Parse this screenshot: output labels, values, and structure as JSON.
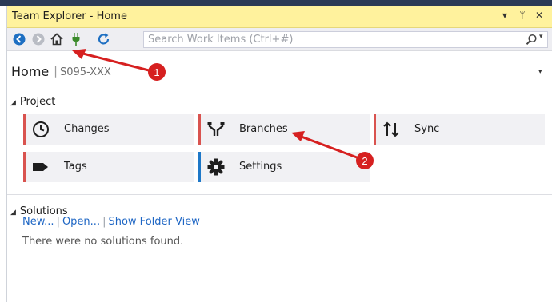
{
  "window": {
    "title": "Team Explorer - Home",
    "controls": {
      "dropdown": "▾",
      "pin": "ᛘ",
      "close": "✕"
    }
  },
  "toolbar": {
    "search_placeholder": "Search Work Items (Ctrl+#)",
    "search_dropdown": "▾",
    "icons": [
      "back-icon",
      "forward-icon",
      "home-icon",
      "plug-icon",
      "refresh-icon",
      "search-icon"
    ]
  },
  "home": {
    "title": "Home",
    "separator": "|",
    "server": "S095-XXX",
    "caret": "▾"
  },
  "project": {
    "header": "Project",
    "collapse_glyph": "◢",
    "tiles": [
      {
        "label": "Changes",
        "icon": "clock-icon",
        "accent": "#d9534f"
      },
      {
        "label": "Branches",
        "icon": "branch-icon",
        "accent": "#d9534f"
      },
      {
        "label": "Sync",
        "icon": "sync-arrows-icon",
        "accent": "#d9534f"
      },
      {
        "label": "Tags",
        "icon": "tag-icon",
        "accent": "#d9534f"
      },
      {
        "label": "Settings",
        "icon": "gear-icon",
        "accent": "#1e78c8"
      }
    ]
  },
  "solutions": {
    "header": "Solutions",
    "collapse_glyph": "◢",
    "links": [
      "New...",
      "Open...",
      "Show Folder View"
    ],
    "link_separator": "|",
    "empty_message": "There were no solutions found."
  },
  "annotations": [
    {
      "number": "1",
      "color": "#d62020"
    },
    {
      "number": "2",
      "color": "#d62020"
    }
  ],
  "colors": {
    "title_bar": "#fff29d",
    "toolbar": "#eeeef2",
    "tile_bg": "#f1f1f4",
    "link": "#1e66c4",
    "annotation_red": "#d62020"
  }
}
